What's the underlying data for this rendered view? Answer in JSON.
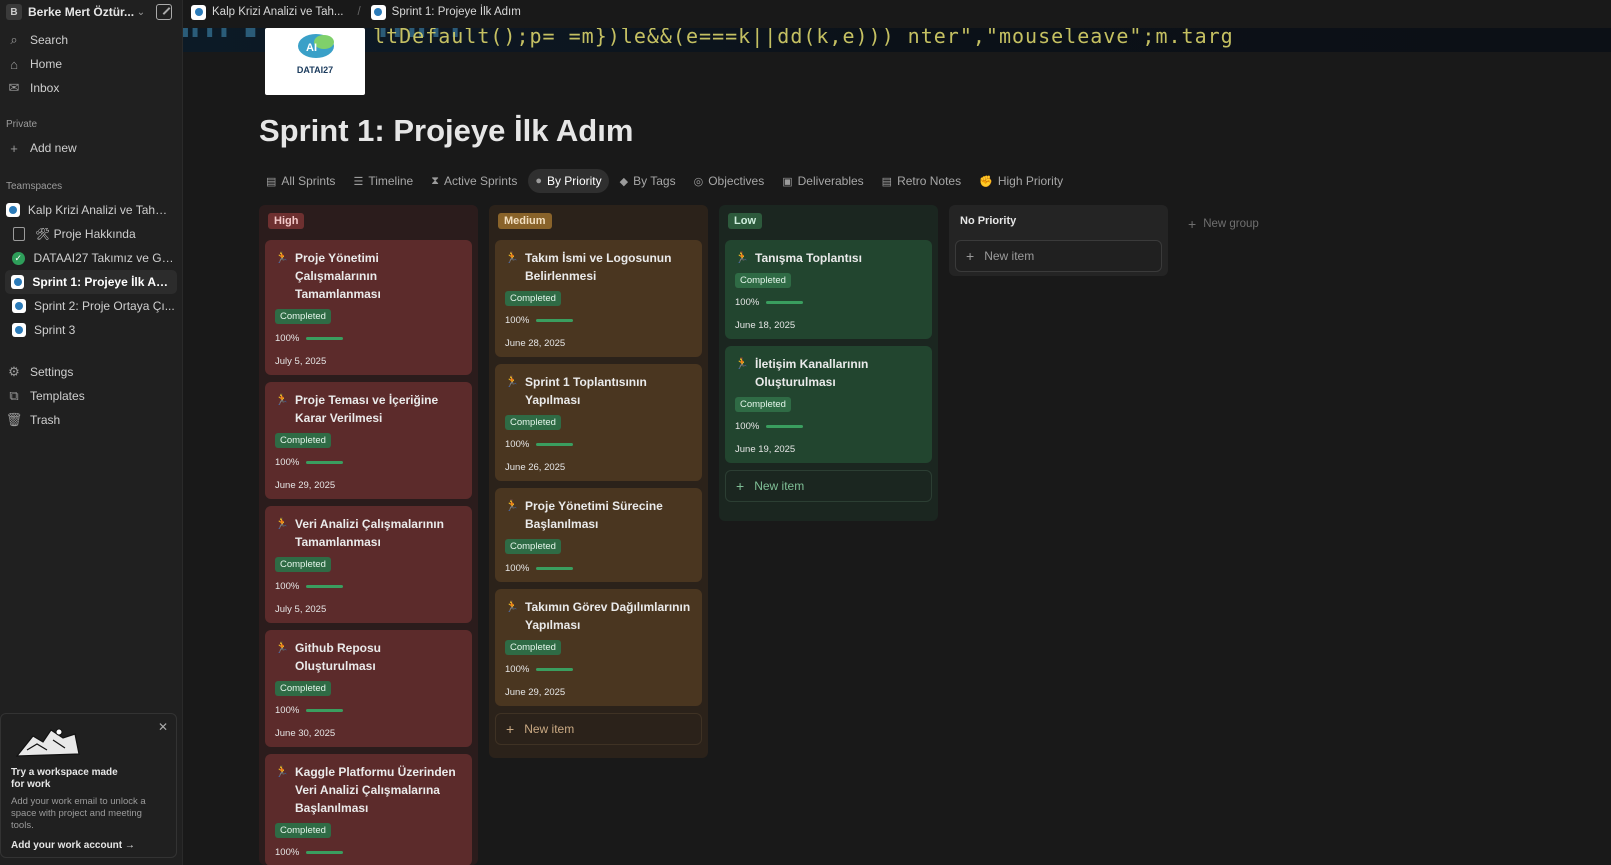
{
  "workspace": {
    "initial": "B",
    "name": "Berke Mert Öztür..."
  },
  "nav": {
    "search": "Search",
    "home": "Home",
    "inbox": "Inbox"
  },
  "private": {
    "label": "Private",
    "add_new": "Add new"
  },
  "teamspaces": {
    "label": "Teamspaces",
    "root": "Kalp Krizi Analizi ve Tahmini",
    "items": [
      {
        "label": "🛠 Proje Hakkında"
      },
      {
        "label": "DATAAI27 Takımız ve Gör..."
      },
      {
        "label": "Sprint 1: Projeye İlk Adım"
      },
      {
        "label": "Sprint 2: Proje Ortaya Çı..."
      },
      {
        "label": "Sprint 3"
      }
    ]
  },
  "footer_nav": {
    "settings": "Settings",
    "templates": "Templates",
    "trash": "Trash"
  },
  "promo": {
    "title": "Try a workspace made for work",
    "desc": "Add your work email to unlock a space with project and meeting tools.",
    "link": "Add your work account →"
  },
  "breadcrumb": {
    "parent": "Kalp Krizi Analizi ve Tah...",
    "current": "Sprint 1: Projeye İlk Adım"
  },
  "cover": {
    "code": "ltDefault();p= =m})le&&(e===k||dd(k,e)))  nter\",\"mouseleave\";m.targ"
  },
  "logo": {
    "name": "DATAI27",
    "brain_text": "AI"
  },
  "page": {
    "title": "Sprint 1: Projeye İlk Adım"
  },
  "tabs": [
    {
      "label": "All Sprints",
      "icon": "▤"
    },
    {
      "label": "Timeline",
      "icon": "☰"
    },
    {
      "label": "Active Sprints",
      "icon": "⧗"
    },
    {
      "label": "By Priority",
      "icon": "●"
    },
    {
      "label": "By Tags",
      "icon": "◆"
    },
    {
      "label": "Objectives",
      "icon": "◎"
    },
    {
      "label": "Deliverables",
      "icon": "▣"
    },
    {
      "label": "Retro Notes",
      "icon": "▤"
    },
    {
      "label": "High Priority",
      "icon": "✊"
    }
  ],
  "board": {
    "high": {
      "label": "High",
      "cards": [
        {
          "title": "Proje Yönetimi Çalışmalarının Tamamlanması",
          "status": "Completed",
          "progress": "100%",
          "date": "July 5, 2025"
        },
        {
          "title": "Proje Teması ve İçeriğine Karar Verilmesi",
          "status": "Completed",
          "progress": "100%",
          "date": "June 29, 2025"
        },
        {
          "title": "Veri Analizi Çalışmalarının Tamamlanması",
          "status": "Completed",
          "progress": "100%",
          "date": "July 5, 2025"
        },
        {
          "title": "Github Reposu Oluşturulması",
          "status": "Completed",
          "progress": "100%",
          "date": "June 30, 2025"
        },
        {
          "title": "Kaggle Platformu Üzerinden Veri Analizi Çalışmalarına Başlanılması",
          "status": "Completed",
          "progress": "100%",
          "date": ""
        }
      ]
    },
    "medium": {
      "label": "Medium",
      "cards": [
        {
          "title": "Takım İsmi ve Logosunun Belirlenmesi",
          "status": "Completed",
          "progress": "100%",
          "date": "June 28, 2025"
        },
        {
          "title": "Sprint 1 Toplantısının Yapılması",
          "status": "Completed",
          "progress": "100%",
          "date": "June 26, 2025"
        },
        {
          "title": "Proje Yönetimi Sürecine Başlanılması",
          "status": "Completed",
          "progress": "100%",
          "date": ""
        },
        {
          "title": "Takımın Görev Dağılımlarının Yapılması",
          "status": "Completed",
          "progress": "100%",
          "date": "June 29, 2025"
        }
      ],
      "new_item": "New item"
    },
    "low": {
      "label": "Low",
      "cards": [
        {
          "title": "Tanışma Toplantısı",
          "status": "Completed",
          "progress": "100%",
          "date": "June 18, 2025"
        },
        {
          "title": "İletişim Kanallarının Oluşturulması",
          "status": "Completed",
          "progress": "100%",
          "date": "June 19, 2025"
        }
      ],
      "new_item": "New item"
    },
    "none": {
      "label": "No Priority",
      "new_item": "New item"
    },
    "new_group": "New group"
  },
  "colors": {
    "high_bg": "#5c2b2b",
    "medium_bg": "#4a3620",
    "low_bg": "#22452f",
    "progress": "#3a9e5f",
    "status_badge": "#2f6b45"
  }
}
